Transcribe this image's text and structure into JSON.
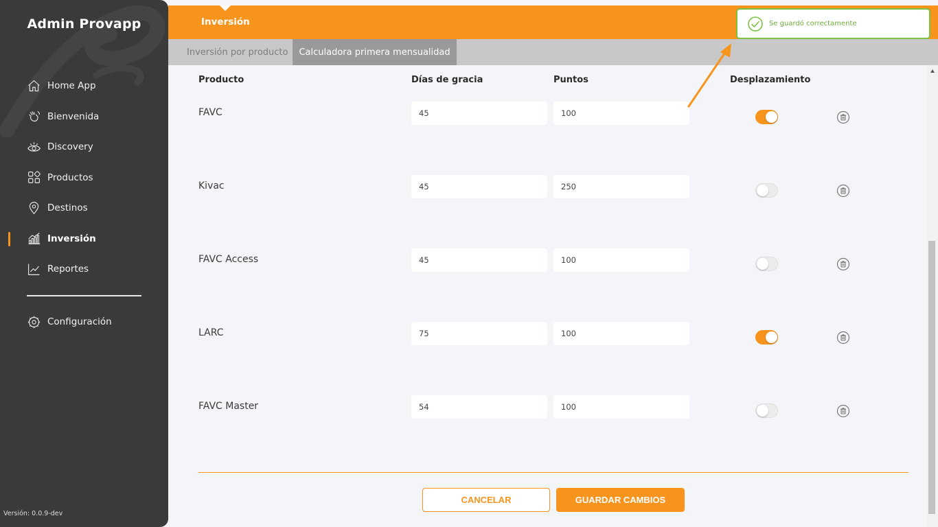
{
  "sidebar": {
    "app_title": "Admin Provapp",
    "items": [
      {
        "label": "Home App",
        "icon": "home-icon"
      },
      {
        "label": "Bienvenida",
        "icon": "wave-hand-icon"
      },
      {
        "label": "Discovery",
        "icon": "eye-icon"
      },
      {
        "label": "Productos",
        "icon": "grid-icon"
      },
      {
        "label": "Destinos",
        "icon": "location-pin-icon"
      },
      {
        "label": "Inversión",
        "icon": "bar-chart-icon",
        "active": true
      },
      {
        "label": "Reportes",
        "icon": "line-chart-icon"
      }
    ],
    "config_label": "Configuración",
    "version": "Versión: 0.0.9-dev"
  },
  "header": {
    "title": "Inversión"
  },
  "tabs": [
    {
      "label": "Inversión por producto",
      "active": false
    },
    {
      "label": "Calculadora primera mensualidad",
      "active": true
    }
  ],
  "table": {
    "columns": {
      "product": "Producto",
      "grace_days": "Días de gracia",
      "points": "Puntos",
      "shift": "Desplazamiento"
    },
    "rows": [
      {
        "product": "FAVC",
        "grace_days": "45",
        "points": "100",
        "shift": true
      },
      {
        "product": "Kivac",
        "grace_days": "45",
        "points": "250",
        "shift": false
      },
      {
        "product": "FAVC Access",
        "grace_days": "45",
        "points": "100",
        "shift": false
      },
      {
        "product": "LARC",
        "grace_days": "75",
        "points": "100",
        "shift": true
      },
      {
        "product": "FAVC Master",
        "grace_days": "54",
        "points": "100",
        "shift": false
      }
    ]
  },
  "actions": {
    "cancel": "CANCELAR",
    "save": "GUARDAR CAMBIOS"
  },
  "toast": {
    "message": "Se guardó correctamente",
    "icon": "check-circle-icon"
  },
  "colors": {
    "accent": "#f7941d",
    "sidebar_bg": "#3a3a3a",
    "success": "#7cc242"
  }
}
